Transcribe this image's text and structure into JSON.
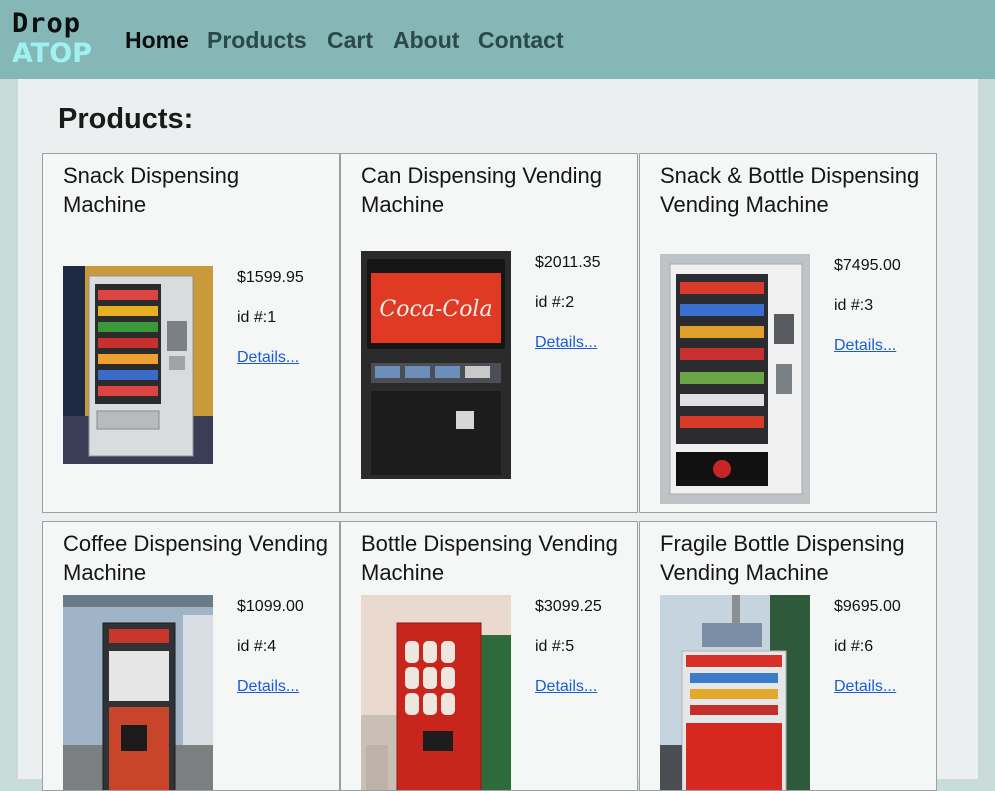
{
  "brand": {
    "top": "Drop",
    "bottom": "ATOP"
  },
  "nav": [
    {
      "label": "Home",
      "active": true
    },
    {
      "label": "Products"
    },
    {
      "label": "Cart"
    },
    {
      "label": "About"
    },
    {
      "label": "Contact"
    }
  ],
  "page": {
    "title": "Products:"
  },
  "products": [
    {
      "title": "Snack Dispensing Machine",
      "price": "$1599.95",
      "id": "id #:1",
      "details": "Details..."
    },
    {
      "title": "Can Dispensing Vending Machine",
      "price": "$2011.35",
      "id": "id #:2",
      "details": "Details..."
    },
    {
      "title": "Snack & Bottle Dispensing Vending Machine",
      "price": "$7495.00",
      "id": "id #:3",
      "details": "Details..."
    },
    {
      "title": "Coffee Dispensing Vending Machine",
      "price": "$1099.00",
      "id": "id #:4",
      "details": "Details..."
    },
    {
      "title": "Bottle Dispensing Vending Machine",
      "price": "$3099.25",
      "id": "id #:5",
      "details": "Details..."
    },
    {
      "title": "Fragile Bottle Dispensing Vending Machine",
      "price": "$9695.00",
      "id": "id #:6",
      "details": "Details..."
    }
  ],
  "colors": {
    "navbar": "#86b7b7",
    "accent_cyan": "#9ff2f0",
    "link": "#1a5bd6"
  },
  "machine_brand": "Coca-Cola"
}
